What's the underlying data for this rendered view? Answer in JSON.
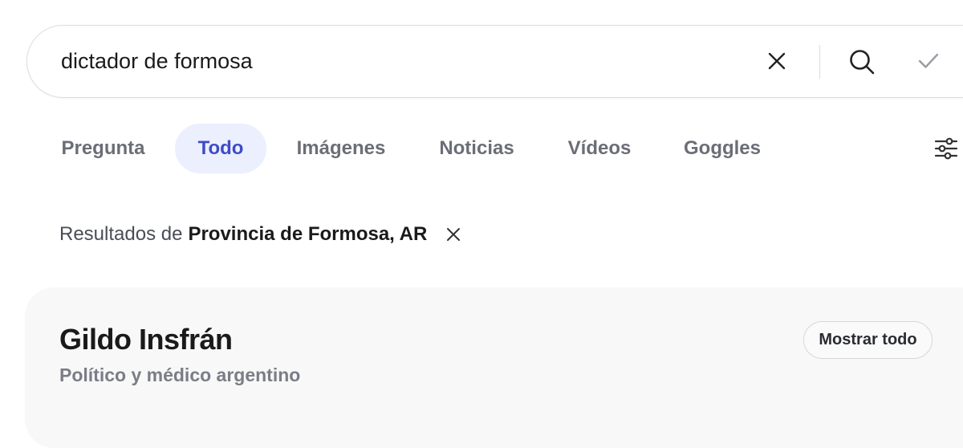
{
  "search": {
    "query": "dictador de formosa"
  },
  "tabs": [
    {
      "label": "Pregunta",
      "active": false
    },
    {
      "label": "Todo",
      "active": true
    },
    {
      "label": "Imágenes",
      "active": false
    },
    {
      "label": "Noticias",
      "active": false
    },
    {
      "label": "Vídeos",
      "active": false
    },
    {
      "label": "Goggles",
      "active": false
    }
  ],
  "location": {
    "prefix": "Resultados de",
    "name": "Provincia de Formosa, AR"
  },
  "knowledge_card": {
    "title": "Gildo Insfrán",
    "subtitle": "Político y médico argentino",
    "show_all_label": "Mostrar todo"
  },
  "colors": {
    "accent": "#3e4cc6",
    "active_tab_bg": "#eceffd",
    "muted_text": "#6b6e76"
  },
  "icons": [
    "close-icon",
    "search-icon",
    "check-icon",
    "sliders-icon"
  ]
}
